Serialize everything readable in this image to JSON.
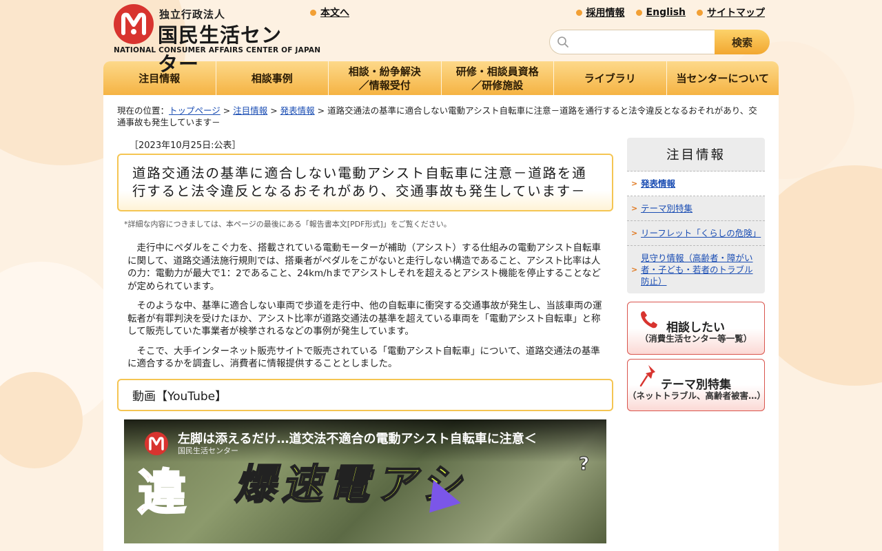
{
  "header": {
    "logo_small": "独立行政法人",
    "logo_big": "国民生活センター",
    "logo_en": "NATIONAL CONSUMER AFFAIRS CENTER OF JAPAN",
    "skip_link": "本文へ",
    "links": [
      "採用情報",
      "English",
      "サイトマップ"
    ],
    "search_placeholder": "",
    "search_button": "検索"
  },
  "nav": [
    "注目情報",
    "相談事例",
    "相談・紛争解決\n／情報受付",
    "研修・相談員資格\n／研修施設",
    "ライブラリ",
    "当センターについて"
  ],
  "breadcrumb": {
    "prefix": "現在の位置：",
    "items": [
      "トップページ",
      "注目情報",
      "発表情報"
    ],
    "current": "道路交通法の基準に適合しない電動アシスト自転車に注意－道路を通行すると法令違反となるおそれがあり、交通事故も発生しています－"
  },
  "article": {
    "date": "［2023年10月25日:公表］",
    "title": "道路交通法の基準に適合しない電動アシスト自転車に注意－道路を通行すると法令違反となるおそれがあり、交通事故も発生しています－",
    "note": "*詳細な内容につきましては、本ページの最後にある「報告書本文[PDF形式]」をご覧ください。",
    "paragraphs": [
      "走行中にペダルをこぐ力を、搭載されている電動モーターが補助（アシスト）する仕組みの電動アシスト自転車に関して、道路交通法施行規則では、搭乗者がペダルをこがないと走行しない構造であること、アシスト比率は人の力：電動力が最大で1：2であること、24km/hまでアシストしそれを超えるとアシスト機能を停止することなどが定められています。",
      "そのような中、基準に適合しない車両で歩道を走行中、他の自転車に衝突する交通事故が発生し、当該車両の運転者が有罪判決を受けたほか、アシスト比率が道路交通法の基準を超えている車両を「電動アシスト自転車」と称して販売していた事業者が検挙されるなどの事例が発生しています。",
      "そこで、大手インターネット販売サイトで販売されている「電動アシスト自転車」について、道路交通法の基準に適合するかを調査し、消費者に情報提供することとしました。"
    ],
    "video_heading": "動画【YouTube】",
    "video": {
      "title": "左脚は添えるだけ…道交法不適合の電動アシスト自転車に注意＜",
      "channel": "国民生活センター",
      "overlay_big": "爆速電アシ",
      "overlay_red": "違",
      "overlay_q": "?"
    }
  },
  "sidebar": {
    "heading": "注目情報",
    "items": [
      "発表情報",
      "テーマ別特集",
      "リーフレット「くらしの危険」",
      "見守り情報（高齢者・障がい者・子ども・若者のトラブル防止）"
    ],
    "active_index": 0,
    "banner1_main": "相談したい",
    "banner1_sub": "（消費生活センター等一覧）",
    "banner2_main": "テーマ別特集",
    "banner2_sub": "（ネットトラブル、高齢者被害…）"
  },
  "colors": {
    "accent_orange": "#f5b343",
    "title_border": "#f5c552",
    "link_blue": "#1a4db3",
    "brand_red": "#d8342f"
  }
}
